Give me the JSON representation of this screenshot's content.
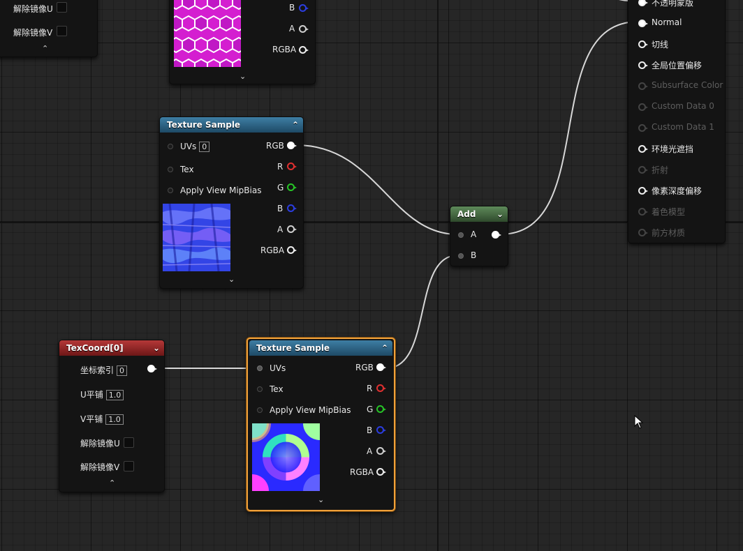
{
  "top_left_node": {
    "mirror_u": "解除镜像U",
    "mirror_v": "解除镜像V",
    "collapse_icon": "chevron-up-icon"
  },
  "top_texture_node": {
    "outputs": [
      "B",
      "A",
      "RGBA"
    ],
    "expand_icon": "chevron-down-icon"
  },
  "texture_sample_1": {
    "title": "Texture Sample",
    "inputs": {
      "uvs": "UVs",
      "uvs_value": "0",
      "tex": "Tex",
      "mipbias": "Apply View MipBias"
    },
    "outputs": {
      "rgb": "RGB",
      "r": "R",
      "g": "G",
      "b": "B",
      "a": "A",
      "rgba": "RGBA"
    }
  },
  "texture_sample_2": {
    "title": "Texture Sample",
    "inputs": {
      "uvs": "UVs",
      "tex": "Tex",
      "mipbias": "Apply View MipBias"
    },
    "outputs": {
      "rgb": "RGB",
      "r": "R",
      "g": "G",
      "b": "B",
      "a": "A",
      "rgba": "RGBA"
    }
  },
  "texcoord_node": {
    "title": "TexCoord[0]",
    "coord_index_label": "坐标索引",
    "coord_index_value": "0",
    "u_tiling_label": "U平铺",
    "u_tiling_value": "1.0",
    "v_tiling_label": "V平铺",
    "v_tiling_value": "1.0",
    "unmirror_u": "解除镜像U",
    "unmirror_v": "解除镜像V"
  },
  "add_node": {
    "title": "Add",
    "input_a": "A",
    "input_b": "B"
  },
  "result_node": {
    "pins": [
      {
        "label": "不透明蒙版",
        "active": true,
        "connected": true
      },
      {
        "label": "Normal",
        "active": true,
        "connected": true
      },
      {
        "label": "切线",
        "active": true,
        "connected": false
      },
      {
        "label": "全局位置偏移",
        "active": true,
        "connected": false
      },
      {
        "label": "Subsurface Color",
        "active": false,
        "connected": false
      },
      {
        "label": "Custom Data 0",
        "active": false,
        "connected": false
      },
      {
        "label": "Custom Data 1",
        "active": false,
        "connected": false
      },
      {
        "label": "环境光遮挡",
        "active": true,
        "connected": false
      },
      {
        "label": "折射",
        "active": false,
        "connected": false
      },
      {
        "label": "像素深度偏移",
        "active": true,
        "connected": false
      },
      {
        "label": "着色模型",
        "active": false,
        "connected": false
      },
      {
        "label": "前方材质",
        "active": false,
        "connected": false
      }
    ]
  },
  "colors": {
    "graph_background": "#262626",
    "selection_outline": "#f0a13a",
    "texture_header": "#2f6a8e",
    "texcoord_header": "#9a2a2a",
    "add_header": "#4a6e47",
    "pin_red": "#e03030",
    "pin_green": "#27c427",
    "pin_blue": "#2b3de0"
  }
}
